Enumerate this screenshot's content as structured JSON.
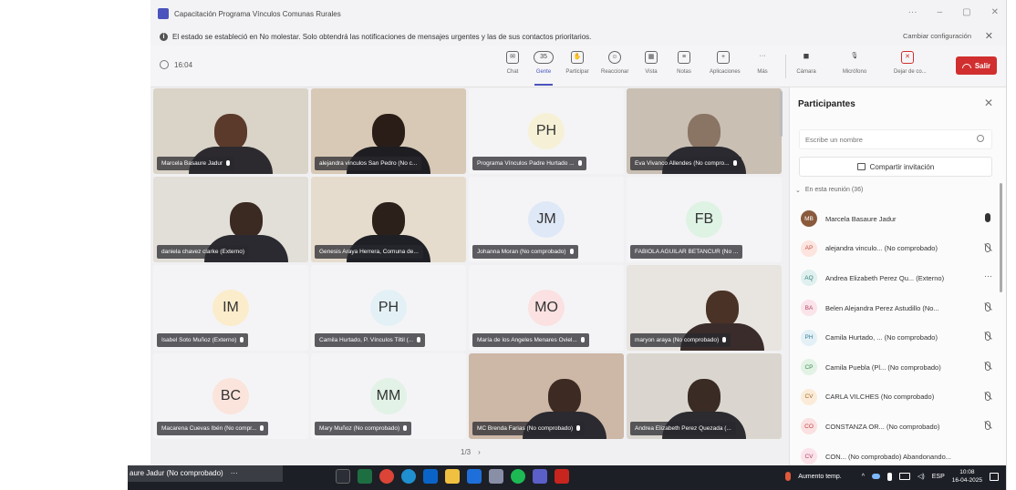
{
  "window": {
    "title": "Capacitación Programa Vínculos Comunas Rurales",
    "controls": [
      "···",
      "–",
      "▢",
      "✕"
    ]
  },
  "notification": {
    "text": "El estado se estableció en No molestar. Solo obtendrá las notificaciones de mensajes urgentes y las de sus contactos prioritarios.",
    "action": "Cambiar configuración",
    "close": "✕"
  },
  "toolbar": {
    "timer": "16:04",
    "people_count": "35",
    "tools": [
      {
        "label": "Chat",
        "glyph": "✉"
      },
      {
        "label": "Gente",
        "glyph": "👥"
      },
      {
        "label": "Participar",
        "glyph": "✋"
      },
      {
        "label": "Reaccionar",
        "glyph": "☺"
      },
      {
        "label": "Vista",
        "glyph": "▦"
      },
      {
        "label": "Notas",
        "glyph": "≡"
      },
      {
        "label": "Aplicaciones",
        "glyph": "+"
      },
      {
        "label": "Más",
        "glyph": "···"
      }
    ],
    "media": [
      {
        "label": "Cámara",
        "glyph": "■"
      },
      {
        "label": "Micrófono",
        "glyph": "🎙"
      },
      {
        "label": "Dejar de co...",
        "glyph": "✕"
      }
    ],
    "leave_label": "Salir"
  },
  "tiles": [
    {
      "name": "Marcela Basaure Jadur",
      "type": "video"
    },
    {
      "name": "alejandra vinculos San Pedro (No c...",
      "type": "video"
    },
    {
      "name": "Programa Vínculos Padre Hurtado ...",
      "type": "avatar",
      "initials": "PH"
    },
    {
      "name": "Eva Vivanco Allendes (No compro...",
      "type": "video"
    },
    {
      "name": "daniela chavez clarke (Externo)",
      "type": "video"
    },
    {
      "name": "Genesis Araya Herrera, Comuna de...",
      "type": "video"
    },
    {
      "name": "Johanna Moran (No comprobado)",
      "type": "avatar",
      "initials": "JM"
    },
    {
      "name": "FABIOLA AGUILAR BETANCUR (No ...",
      "type": "avatar",
      "initials": "FB"
    },
    {
      "name": "Isabel Soto Muñoz (Externo)",
      "type": "avatar",
      "initials": "IM"
    },
    {
      "name": "Camila Hurtado, P. Vínculos Tiltil (...",
      "type": "avatar",
      "initials": "PH"
    },
    {
      "name": "María de los Angeles Menares Oviel...",
      "type": "avatar",
      "initials": "MO"
    },
    {
      "name": "maryon araya (No comprobado)",
      "type": "video"
    },
    {
      "name": "Macarena Cuevas Ibén (No compr...",
      "type": "avatar",
      "initials": "BC"
    },
    {
      "name": "Mary Muñoz (No comprobado)",
      "type": "avatar",
      "initials": "MM"
    },
    {
      "name": "MC Brenda Farias (No comprobado)",
      "type": "video"
    },
    {
      "name": "Andrea Elizabeth Perez Quezada (...",
      "type": "video"
    }
  ],
  "pager": {
    "text": "1/3",
    "next": "›"
  },
  "participants": {
    "title": "Participantes",
    "close": "✕",
    "search_placeholder": "Escribe un nombre",
    "share_label": "Compartir invitación",
    "section_chevron": "⌄",
    "section_label": "En esta reunión (36)",
    "people": [
      {
        "initials": "MB",
        "name": "Marcela Basaure Jadur",
        "mic": "on"
      },
      {
        "initials": "AP",
        "name": "alejandra vinculo... (No comprobado)",
        "mic": "off"
      },
      {
        "initials": "AQ",
        "name": "Andrea Elizabeth Perez Qu... (Externo)",
        "mic": "more"
      },
      {
        "initials": "BA",
        "name": "Belen Alejandra Perez Astudillo (No...",
        "mic": "off"
      },
      {
        "initials": "PH",
        "name": "Camila Hurtado, ... (No comprobado)",
        "mic": "off"
      },
      {
        "initials": "CP",
        "name": "Camila Puebla (Pl... (No comprobado)",
        "mic": "off"
      },
      {
        "initials": "CV",
        "name": "CARLA VILCHES (No comprobado)",
        "mic": "off"
      },
      {
        "initials": "CO",
        "name": "CONSTANZA OR... (No comprobado)",
        "mic": "off"
      },
      {
        "initials": "CV",
        "name": "CON... (No comprobado)   Abandonando...",
        "mic": "none"
      }
    ]
  },
  "taskbar": {
    "mini_tile": "aure Jadur (No comprobado)",
    "mini_more": "···",
    "weather": "Aumento temp.",
    "lang": "ESP",
    "time": "10:08",
    "date": "16-04-2025"
  },
  "colors": {
    "accent": "#4b53bc",
    "leave": "#d12f2f"
  }
}
